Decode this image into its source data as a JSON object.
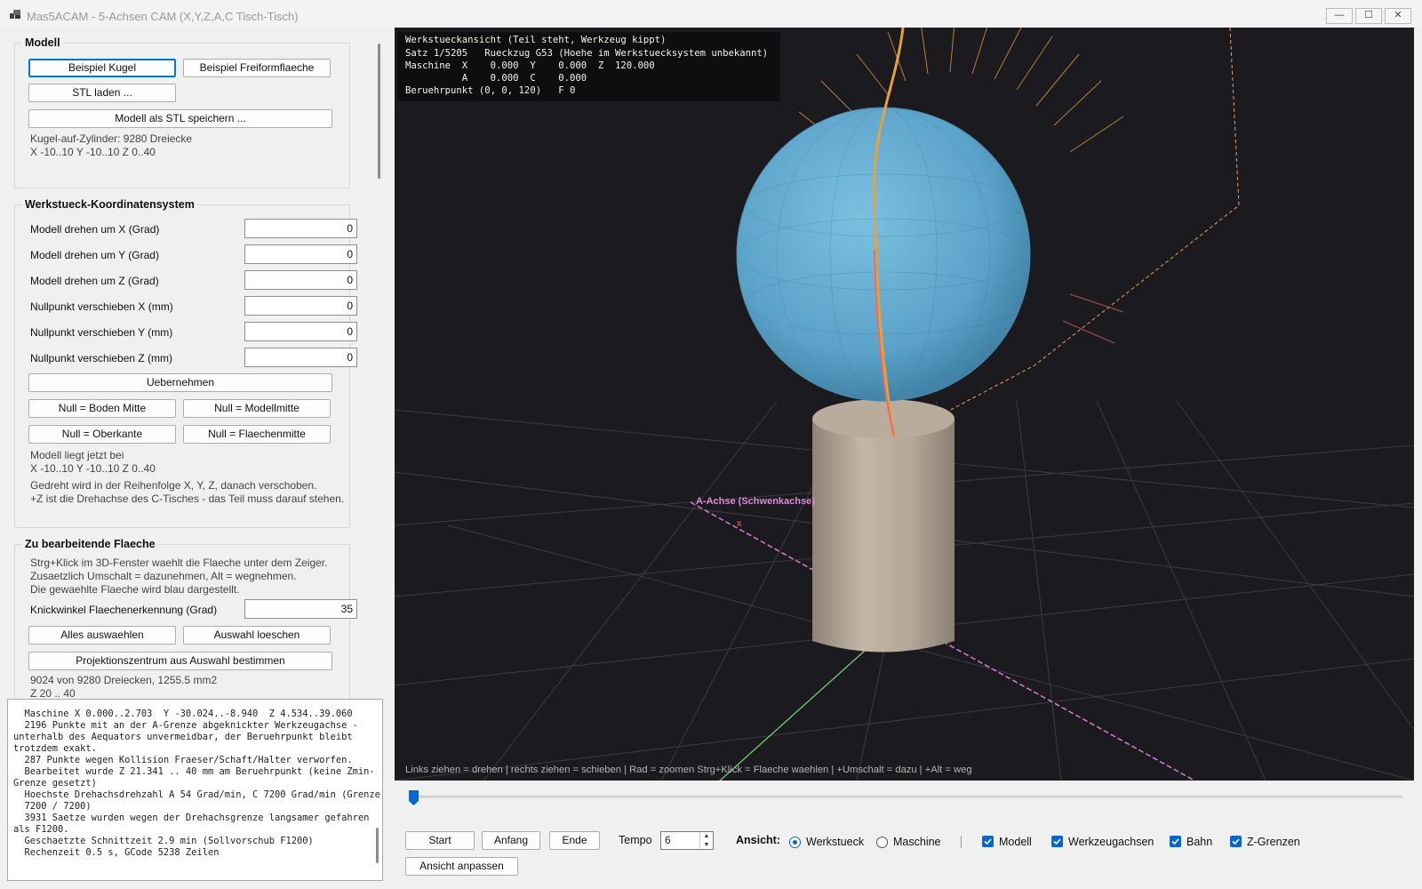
{
  "window": {
    "title": "Mas5ACAM - 5-Achsen CAM (X,Y,Z,A,C Tisch-Tisch)",
    "controls": [
      "—",
      "☐",
      "✕"
    ]
  },
  "modell": {
    "title": "Modell",
    "btn_beispiel_kugel": "Beispiel Kugel",
    "btn_beispiel_freiform": "Beispiel Freiformflaeche",
    "btn_stl_laden": "STL laden ...",
    "btn_stl_speichern": "Modell als STL speichern ...",
    "info_line1": "Kugel-auf-Zylinder: 9280 Dreiecke",
    "info_line2": "X -10..10  Y -10..10  Z 0..40"
  },
  "wks": {
    "title": "Werkstueck-Koordinatensystem",
    "rows": [
      {
        "label": "Modell drehen um X (Grad)",
        "value": "0"
      },
      {
        "label": "Modell drehen um Y (Grad)",
        "value": "0"
      },
      {
        "label": "Modell drehen um Z (Grad)",
        "value": "0"
      },
      {
        "label": "Nullpunkt verschieben X (mm)",
        "value": "0"
      },
      {
        "label": "Nullpunkt verschieben Y (mm)",
        "value": "0"
      },
      {
        "label": "Nullpunkt verschieben Z (mm)",
        "value": "0"
      }
    ],
    "btn_uebernehmen": "Uebernehmen",
    "btn_null_boden": "Null = Boden Mitte",
    "btn_null_modellmitte": "Null = Modellmitte",
    "btn_null_oberkante": "Null = Oberkante",
    "btn_null_flaechenmitte": "Null = Flaechenmitte",
    "info_line1": "Modell liegt jetzt bei",
    "info_line2": "X -10..10  Y -10..10  Z 0..40",
    "note_line1": "Gedreht wird in der Reihenfolge X, Y, Z, danach verschoben.",
    "note_line2": "+Z ist die Drehachse des C-Tisches - das Teil muss darauf stehen."
  },
  "flaeche": {
    "title": "Zu bearbeitende Flaeche",
    "hint_line1": "Strg+Klick im 3D-Fenster waehlt die Flaeche unter dem Zeiger.",
    "hint_line2": "Zusaetzlich Umschalt = dazunehmen, Alt = wegnehmen.",
    "hint_line3": "Die gewaehlte Flaeche wird blau dargestellt.",
    "knick_label": "Knickwinkel Flaechenerkennung (Grad)",
    "knick_value": "35",
    "btn_alles": "Alles auswaehlen",
    "btn_auswahl_loeschen": "Auswahl loeschen",
    "btn_projektion": "Projektionszentrum aus Auswahl bestimmen",
    "info_line1": "9024 von 9280 Dreiecken, 1255.5 mm2",
    "info_line2": "Z 20 .. 40"
  },
  "log": {
    "lines": [
      "  Maschine X 0.000..2.703  Y -30.024..-8.940  Z 4.534..39.060",
      "  2196 Punkte mit an der A-Grenze abgeknickter Werkzeugachse -",
      "unterhalb des Aequators unvermeidbar, der Beruehrpunkt bleibt",
      "trotzdem exakt.",
      "  287 Punkte wegen Kollision Fraeser/Schaft/Halter verworfen.",
      "  Bearbeitet wurde Z 21.341 .. 40 mm am Beruehrpunkt (keine Zmin-",
      "Grenze gesetzt)",
      "  Hoechste Drehachsdrehzahl A 54 Grad/min, C 7200 Grad/min (Grenze",
      "  7200 / 7200)",
      "  3931 Saetze wurden wegen der Drehachsgrenze langsamer gefahren",
      "als F1200.",
      "  Geschaetzte Schnittzeit 2.9 min (Sollvorschub F1200)",
      "  Rechenzeit 0.5 s, GCode 5238 Zeilen"
    ]
  },
  "viewport": {
    "hud_lines": [
      "Werkstueckansicht (Teil steht, Werkzeug kippt)",
      "Satz 1/5205   Rueckzug G53 (Hoehe im Werkstuecksystem unbekannt)",
      "Maschine  X    0.000  Y    0.000  Z  120.000",
      "          A    0.000  C    0.000",
      "Beruehrpunkt (0, 0, 120)   F 0"
    ],
    "axis_label": "A-Achse (Schwenkachse)",
    "axis_marker": "x",
    "hint": "Links ziehen = drehen | rechts ziehen = schieben | Rad = zoomen     Strg+Klick = Flaeche waehlen | +Umschalt = dazu | +Alt = weg",
    "colors": {
      "background": "#1b1b1f",
      "grid": "#3a3a3e",
      "sphere": "#5fa9cf",
      "cylinder": "#b6a99a",
      "tool_axes": "#e6a23c",
      "a_axis": "#d77ad6",
      "green_axis": "#6fcf6f",
      "limit_lines": "#e8a060"
    }
  },
  "playback": {
    "slider_position": 0,
    "btn_start": "Start",
    "btn_anfang": "Anfang",
    "btn_ende": "Ende",
    "tempo_label": "Tempo",
    "tempo_value": "6",
    "btn_ansicht_anpassen": "Ansicht anpassen",
    "ansicht_label": "Ansicht:",
    "radio_werkstueck": "Werkstueck",
    "radio_maschine": "Maschine",
    "selected_view": "Werkstueck",
    "chk_modell": "Modell",
    "chk_werkzeugachsen": "Werkzeugachsen",
    "chk_bahn": "Bahn",
    "chk_zgrenzen": "Z-Grenzen"
  }
}
